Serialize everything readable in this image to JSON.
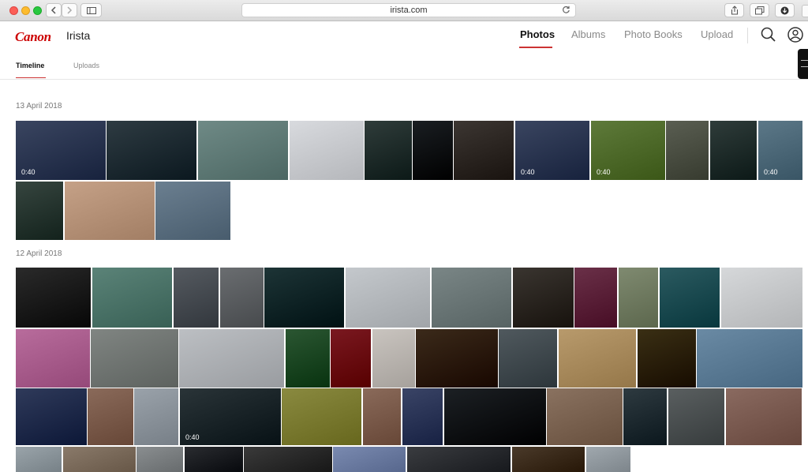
{
  "browser": {
    "url": "irista.com"
  },
  "header": {
    "brand": "Canon",
    "product": "Irista",
    "nav": [
      {
        "label": "Photos",
        "active": true
      },
      {
        "label": "Albums",
        "active": false
      },
      {
        "label": "Photo Books",
        "active": false
      },
      {
        "label": "Upload",
        "active": false
      }
    ]
  },
  "subtabs": [
    {
      "label": "Timeline",
      "active": true
    },
    {
      "label": "Uploads",
      "active": false
    }
  ],
  "sections": [
    {
      "date": "13 April 2018"
    },
    {
      "date": "12 April 2018"
    }
  ],
  "photos": [
    {
      "subject": "mountain sunset",
      "duration": "0:40",
      "color": "#3a4560"
    },
    {
      "subject": "flat lay desk",
      "duration": "",
      "color": "#2e3b42"
    },
    {
      "subject": "lake with boats",
      "duration": "",
      "color": "#6f8a86"
    },
    {
      "subject": "spreadsheet print",
      "duration": "",
      "color": "#d8dade"
    },
    {
      "subject": "foggy forest",
      "duration": "",
      "color": "#2f3c3a"
    },
    {
      "subject": "food bowl",
      "duration": "",
      "color": "#1a1e22"
    },
    {
      "subject": "gorilla",
      "duration": "",
      "color": "#3c3632"
    },
    {
      "subject": "mountain sunset",
      "duration": "0:40",
      "color": "#3a4560"
    },
    {
      "subject": "fox in grass",
      "duration": "0:40",
      "color": "#5e7a3a"
    },
    {
      "subject": "aerial city",
      "duration": "",
      "color": "#5a5e52"
    },
    {
      "subject": "foggy forest",
      "duration": "",
      "color": "#2f3c3a"
    },
    {
      "subject": "ocean waves",
      "duration": "0:40",
      "color": "#5c7888"
    },
    {
      "subject": "foggy forest",
      "duration": "",
      "color": "#36453f"
    },
    {
      "subject": "bird on sand",
      "duration": "",
      "color": "#c5a187"
    },
    {
      "subject": "yosemite valley",
      "duration": "",
      "color": "#6b7f90"
    },
    {
      "subject": "curved architecture",
      "duration": "",
      "color": "#2a2a2a"
    },
    {
      "subject": "surfer in ocean",
      "duration": "",
      "color": "#5b8378"
    },
    {
      "subject": "plane wreck",
      "duration": "",
      "color": "#555a60"
    },
    {
      "subject": "dam wall",
      "duration": "",
      "color": "#6a6d70"
    },
    {
      "subject": "palm trees night",
      "duration": "",
      "color": "#1d3436"
    },
    {
      "subject": "clouds over peaks",
      "duration": "",
      "color": "#c4c8cc"
    },
    {
      "subject": "rocky coast",
      "duration": "",
      "color": "#7a8686"
    },
    {
      "subject": "gorilla",
      "duration": "",
      "color": "#3a3530"
    },
    {
      "subject": "light streaks",
      "duration": "",
      "color": "#6a3048"
    },
    {
      "subject": "mountain valley",
      "duration": "",
      "color": "#7f8a70"
    },
    {
      "subject": "aerial waves",
      "duration": "",
      "color": "#2b5a60"
    },
    {
      "subject": "white curves",
      "duration": "",
      "color": "#d6d8da"
    },
    {
      "subject": "pink flower butterfly",
      "duration": "",
      "color": "#b86c9c"
    },
    {
      "subject": "misty road",
      "duration": "",
      "color": "#808582"
    },
    {
      "subject": "island reflection",
      "duration": "",
      "color": "#bcbfc3"
    },
    {
      "subject": "palm leaves",
      "duration": "",
      "color": "#2b5632"
    },
    {
      "subject": "red neon",
      "duration": "",
      "color": "#7a1820"
    },
    {
      "subject": "tower buildings",
      "duration": "",
      "color": "#c9c4bf"
    },
    {
      "subject": "campfire night",
      "duration": "",
      "color": "#3b2a1a"
    },
    {
      "subject": "mountain lake",
      "duration": "",
      "color": "#50595e"
    },
    {
      "subject": "beach aerial",
      "duration": "",
      "color": "#b89a6c"
    },
    {
      "subject": "night lights",
      "duration": "",
      "color": "#3a2f14"
    },
    {
      "subject": "snowy peaks",
      "duration": "",
      "color": "#6a8aa4"
    },
    {
      "subject": "mountain lake dusk",
      "duration": "",
      "color": "#2f3a5a"
    },
    {
      "subject": "food plates",
      "duration": "",
      "color": "#8a6a5a"
    },
    {
      "subject": "snowy mountain",
      "duration": "",
      "color": "#9aa2aa"
    },
    {
      "subject": "night valley",
      "duration": "0:40",
      "color": "#2a3438"
    },
    {
      "subject": "sunset field",
      "duration": "",
      "color": "#8a8a40"
    },
    {
      "subject": "food plates",
      "duration": "",
      "color": "#8a6a5a"
    },
    {
      "subject": "dusk sky",
      "duration": "",
      "color": "#3a4466"
    },
    {
      "subject": "abstract dark",
      "duration": "",
      "color": "#1c2024"
    },
    {
      "subject": "canyon dusk",
      "duration": "",
      "color": "#8a7260"
    },
    {
      "subject": "storm clouds",
      "duration": "",
      "color": "#2e3a40"
    },
    {
      "subject": "blue umbrella",
      "duration": "",
      "color": "#5a5f60"
    },
    {
      "subject": "half dome",
      "duration": "",
      "color": "#8a6a60"
    },
    {
      "subject": "photo",
      "duration": "",
      "color": "#9aa4aa"
    },
    {
      "subject": "photo",
      "duration": "",
      "color": "#8a7a6a"
    },
    {
      "subject": "photo",
      "duration": "",
      "color": "#8a8e90"
    },
    {
      "subject": "photo",
      "duration": "",
      "color": "#2a2c30"
    },
    {
      "subject": "photo",
      "duration": "",
      "color": "#3a3a3a"
    },
    {
      "subject": "photo",
      "duration": "",
      "color": "#7a8ab0"
    },
    {
      "subject": "photo",
      "duration": "",
      "color": "#3a3c40"
    },
    {
      "subject": "photo",
      "duration": "",
      "color": "#4a3a2a"
    },
    {
      "subject": "photo",
      "duration": "",
      "color": "#a0a8ae"
    }
  ]
}
